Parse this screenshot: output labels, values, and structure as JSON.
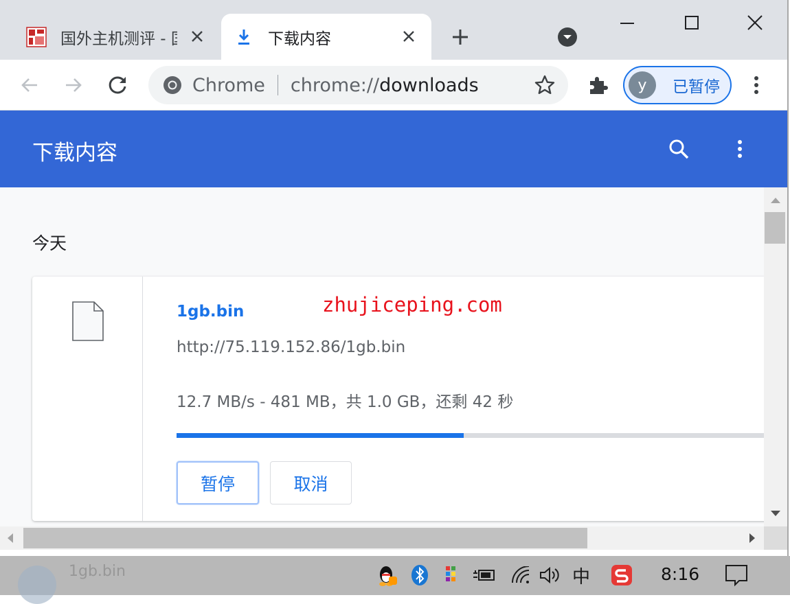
{
  "tabs": [
    {
      "title": "国外主机测评 - 国",
      "active": false
    },
    {
      "title": "下载内容",
      "active": true
    }
  ],
  "omnibox": {
    "site_label": "Chrome",
    "url_scheme": "chrome://",
    "url_host": "downloads"
  },
  "profile": {
    "initial": "y",
    "label": "已暂停"
  },
  "page": {
    "title": "下载内容"
  },
  "downloads": {
    "date_heading": "今天",
    "item": {
      "file_name": "1gb.bin",
      "watermark": "zhujiceping.com",
      "url": "http://75.119.152.86/1gb.bin",
      "status": "12.7 MB/s - 481 MB，共 1.0 GB，还剩 42 秒",
      "progress_fraction": 0.481,
      "pause_label": "暂停",
      "cancel_label": "取消"
    }
  },
  "taskbar": {
    "ghost_title": "1gb.bin",
    "ime": "中",
    "time": "8:16"
  },
  "colors": {
    "header_blue": "#3367d6",
    "accent_blue": "#1a73e8",
    "watermark_red": "#e8121c",
    "tabstrip": "#dee1e6"
  },
  "icons": [
    "favicon-site-icon",
    "download-icon",
    "close-icon",
    "plus-icon",
    "tab-search-icon",
    "minimize-icon",
    "maximize-icon",
    "back-arrow-icon",
    "forward-arrow-icon",
    "reload-icon",
    "chrome-logo-icon",
    "star-icon",
    "extensions-puzzle-icon",
    "kebab-menu-icon",
    "search-icon",
    "file-icon",
    "qq-icon",
    "bluetooth-icon",
    "app-grid-icon",
    "battery-plug-icon",
    "wifi-icon",
    "volume-icon",
    "sogou-ime-icon",
    "notification-icon"
  ]
}
